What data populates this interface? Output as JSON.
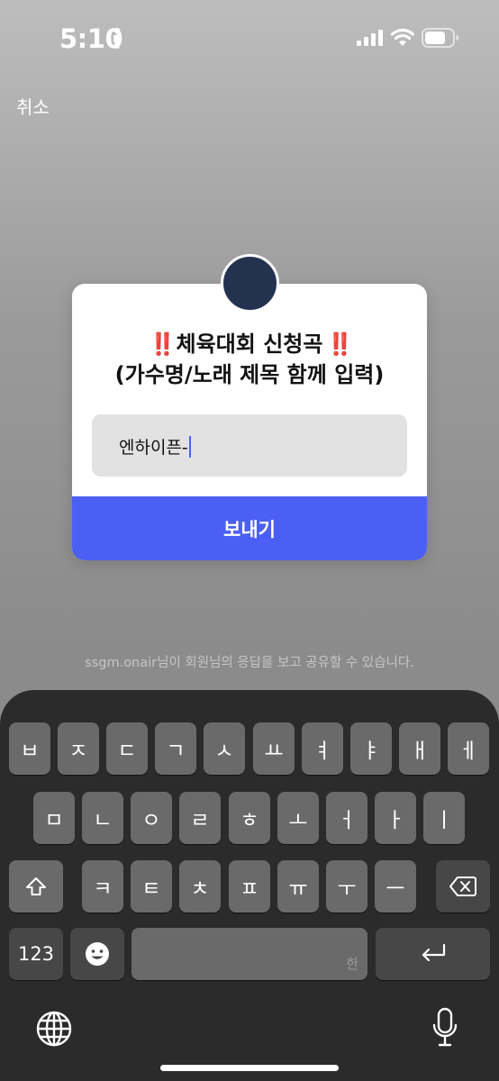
{
  "status_bar": {
    "time": "5:10"
  },
  "header": {
    "cancel_label": "취소"
  },
  "question_card": {
    "emoji": "‼️",
    "question_line1": "체육대회 신청곡",
    "question_line2": "(가수명/노래 제목 함께 입력)",
    "answer_value": "엔하이픈-",
    "send_label": "보내기"
  },
  "notice": "ssgm.onair님이 회원님의 응답을 보고 공유할 수 있습니다.",
  "keyboard": {
    "row1": [
      "ㅂ",
      "ㅈ",
      "ㄷ",
      "ㄱ",
      "ㅅ",
      "ㅛ",
      "ㅕ",
      "ㅑ",
      "ㅐ",
      "ㅔ"
    ],
    "row2": [
      "ㅁ",
      "ㄴ",
      "ㅇ",
      "ㄹ",
      "ㅎ",
      "ㅗ",
      "ㅓ",
      "ㅏ",
      "ㅣ"
    ],
    "row3": [
      "ㅋ",
      "ㅌ",
      "ㅊ",
      "ㅍ",
      "ㅠ",
      "ㅜ",
      "ㅡ"
    ],
    "numbers_label": "123",
    "space_hint": "한",
    "icons": [
      "shift-icon",
      "backspace-icon",
      "emoji-icon",
      "return-icon",
      "globe-icon",
      "microphone-icon"
    ]
  }
}
